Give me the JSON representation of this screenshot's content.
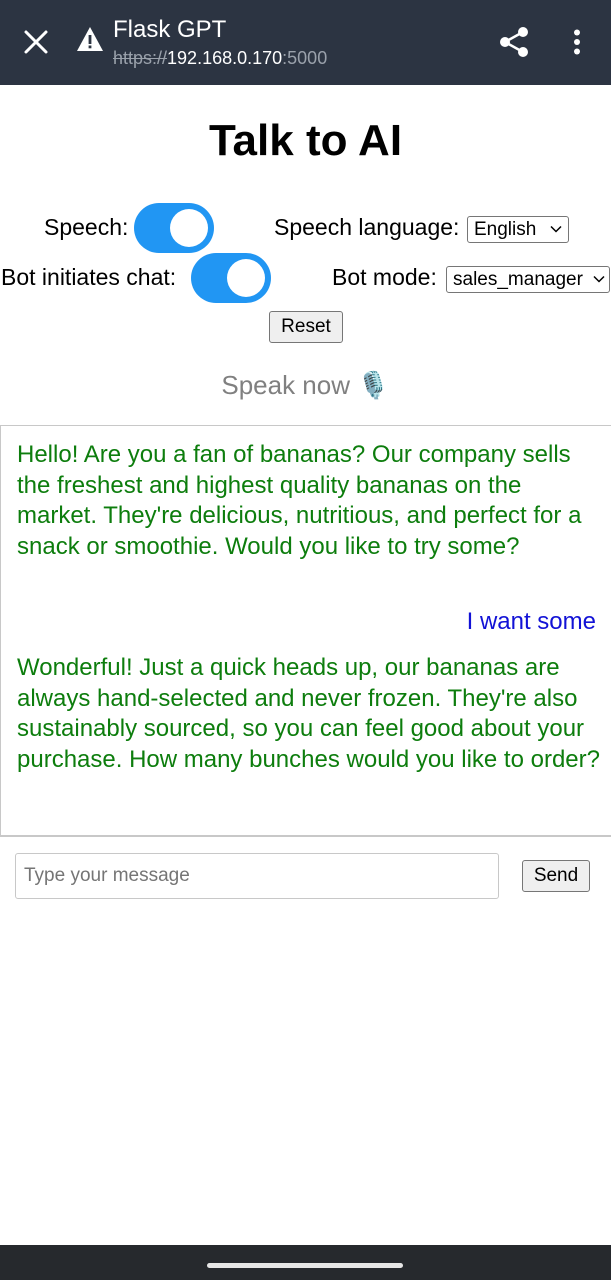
{
  "browser": {
    "title": "Flask GPT",
    "url_scheme": "https://",
    "url_host": "192.168.0.170",
    "url_port": ":5000",
    "icons": [
      "close-icon",
      "warning-icon",
      "share-icon",
      "more-vert-icon"
    ]
  },
  "page": {
    "heading": "Talk to AI",
    "speech_label": "Speech:",
    "speech_enabled": true,
    "speech_language_label": "Speech language:",
    "speech_language_value": "English",
    "bot_initiates_label": "Bot initiates chat:",
    "bot_initiates_enabled": true,
    "bot_mode_label": "Bot mode:",
    "bot_mode_value": "sales_manager",
    "reset_label": "Reset",
    "speak_now": "Speak now",
    "mic_icon": "🎙️"
  },
  "chat": {
    "messages": [
      {
        "role": "bot",
        "text": "Hello! Are you a fan of bananas? Our company sells the freshest and highest quality bananas on the market. They're delicious, nutritious, and perfect for a snack or smoothie. Would you like to try some?"
      },
      {
        "role": "user",
        "text": "I want some"
      },
      {
        "role": "bot",
        "text": "Wonderful! Just a quick heads up, our bananas are always hand-selected and never frozen. They're also sustainably sourced, so you can feel good about your purchase. How many bunches would you like to order?"
      }
    ],
    "input_placeholder": "Type your message",
    "send_label": "Send"
  },
  "colors": {
    "topbar": "#2c3442",
    "toggle_on": "#2196f3",
    "bot_text": "#0d7d0d",
    "user_text": "#1212d6"
  }
}
